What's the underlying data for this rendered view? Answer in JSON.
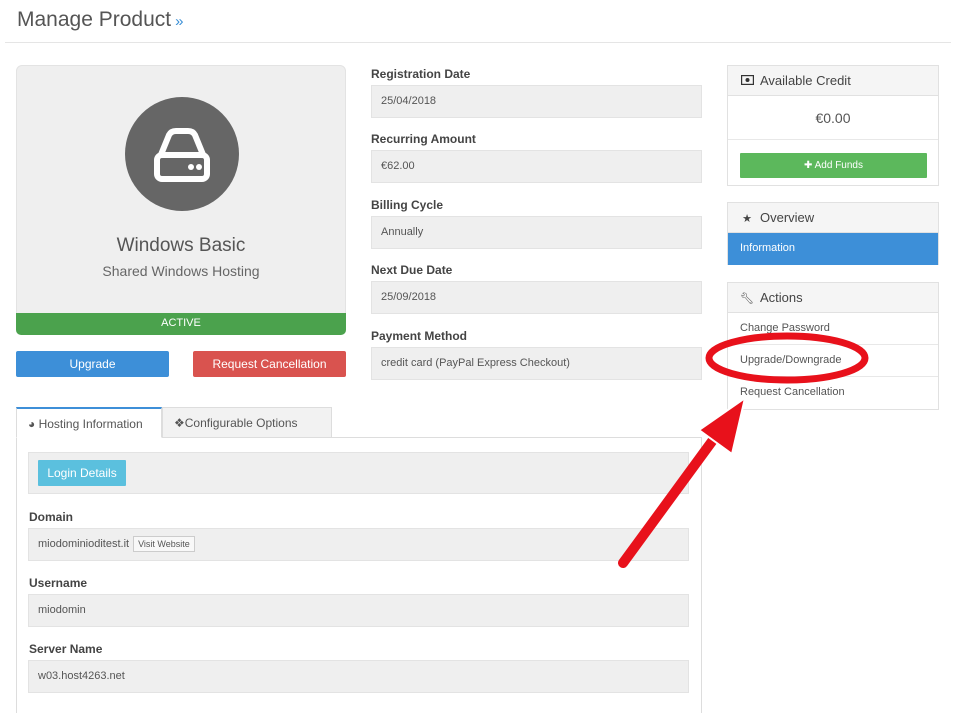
{
  "page": {
    "title": "Manage Product",
    "title_suffix": "»"
  },
  "product": {
    "name": "Windows Basic",
    "group": "Shared Windows Hosting",
    "status": "ACTIVE",
    "upgrade_label": "Upgrade",
    "cancel_label": "Request Cancellation"
  },
  "details": [
    {
      "label": "Registration Date",
      "value": "25/04/2018"
    },
    {
      "label": "Recurring Amount",
      "value": "€62.00"
    },
    {
      "label": "Billing Cycle",
      "value": "Annually"
    },
    {
      "label": "Next Due Date",
      "value": "25/09/2018"
    },
    {
      "label": "Payment Method",
      "value": "credit card (PayPal Express Checkout)"
    }
  ],
  "credit": {
    "title": "Available Credit",
    "amount": "€0.00",
    "add_funds_label": "Add Funds"
  },
  "overview": {
    "title": "Overview",
    "items": [
      {
        "label": "Information"
      }
    ]
  },
  "actions": {
    "title": "Actions",
    "items": [
      {
        "label": "Change Password"
      },
      {
        "label": "Upgrade/Downgrade"
      },
      {
        "label": "Request Cancellation"
      }
    ]
  },
  "tabs": [
    {
      "label": "Hosting Information"
    },
    {
      "label": "Configurable Options"
    }
  ],
  "hosting": {
    "login_label": "Login Details",
    "domain_label": "Domain",
    "domain_value": "miodominioditest.it",
    "visit_label": "Visit Website",
    "username_label": "Username",
    "username_value": "miodomin",
    "server_label": "Server Name",
    "server_value": "w03.host4263.net"
  },
  "colors": {
    "primary": "#3d8fd8",
    "success": "#4ba24d",
    "danger": "#d9534f",
    "info": "#5bc0de",
    "annotation": "#e8111b"
  }
}
